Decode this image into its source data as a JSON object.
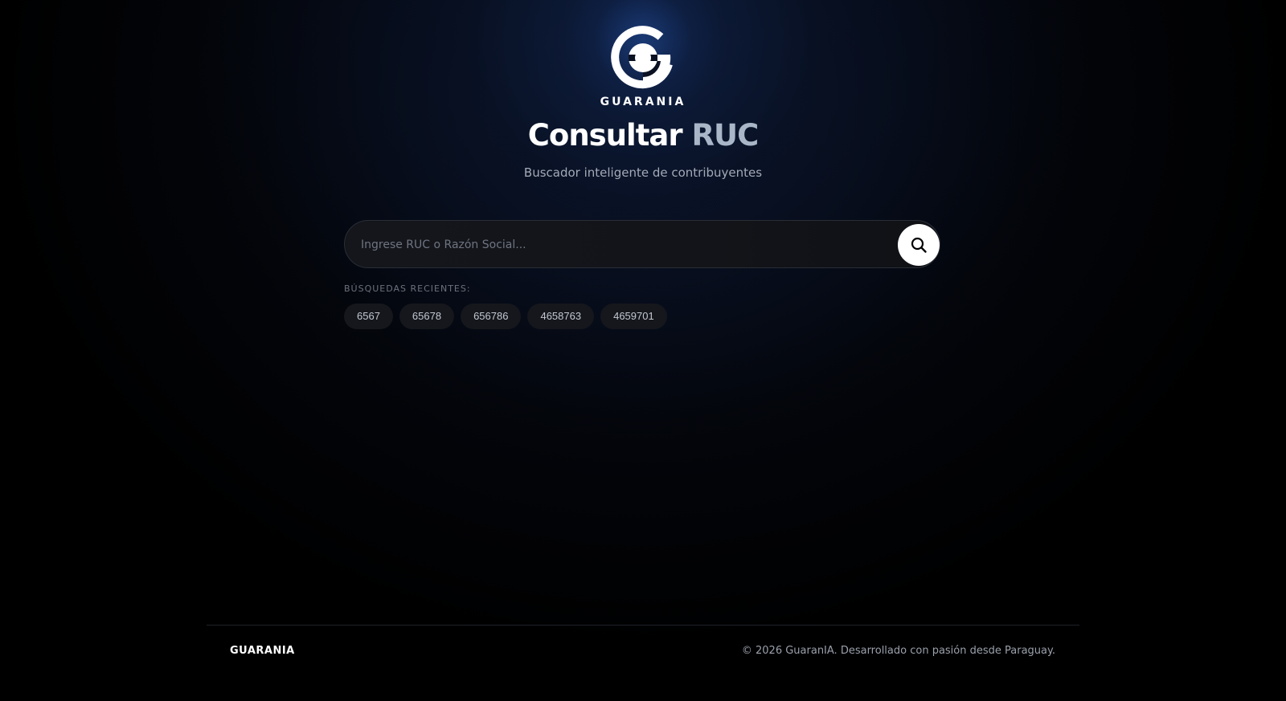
{
  "brand": {
    "name": "GUARANIA",
    "logo_icon": "guarania-logo-icon"
  },
  "hero": {
    "title_part1": "Consultar",
    "title_part2": "RUC",
    "subtitle": "Buscador inteligente de contribuyentes"
  },
  "search": {
    "placeholder": "Ingrese RUC o Razón Social...",
    "value": "",
    "button_icon": "search-icon"
  },
  "recent": {
    "label": "BÚSQUEDAS RECIENTES:",
    "items": [
      "6567",
      "65678",
      "656786",
      "4658763",
      "4659701"
    ]
  },
  "footer": {
    "brand": "GUARANIA",
    "copyright": "© 2026 GuaranIA. Desarrollado con pasión desde Paraguay."
  },
  "colors": {
    "background": "#000000",
    "accent_glow": "#1c3f80",
    "title_secondary": "#a9b6c8",
    "button_bg": "#ffffff"
  }
}
